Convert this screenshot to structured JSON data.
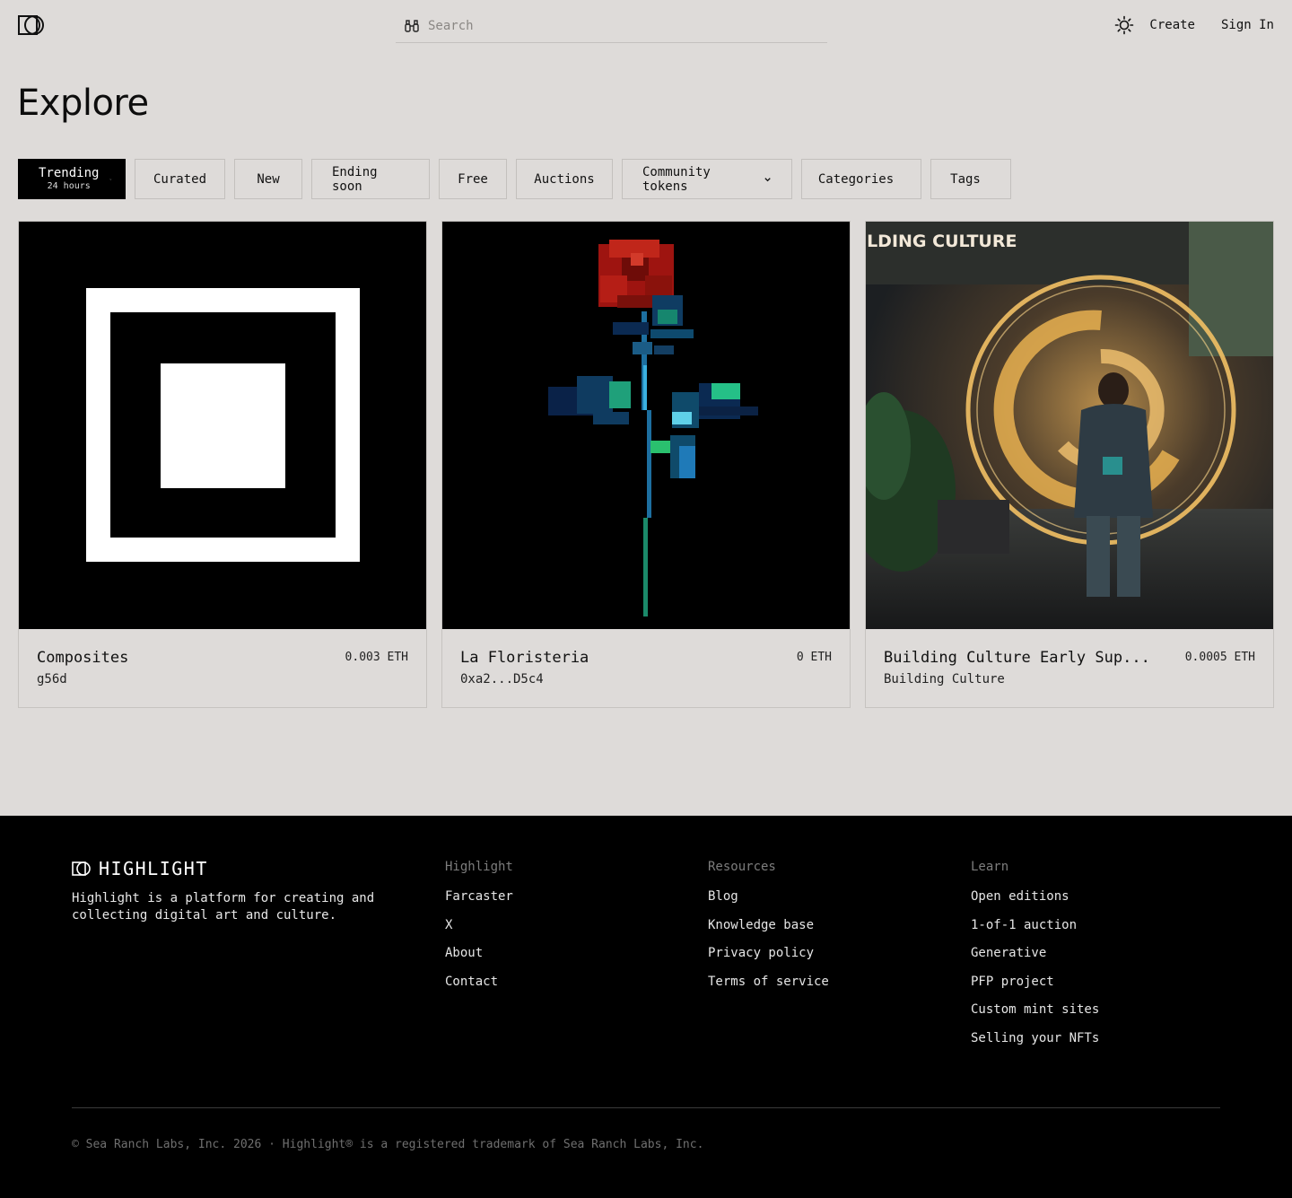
{
  "header": {
    "search_placeholder": "Search",
    "create_label": "Create",
    "signin_label": "Sign In"
  },
  "page": {
    "title": "Explore"
  },
  "filters": {
    "trending_label": "Trending",
    "trending_period": "24 hours",
    "items": [
      "Curated",
      "New",
      "Ending soon",
      "Free",
      "Auctions"
    ],
    "community_tokens": "Community tokens",
    "categories": "Categories",
    "tags": "Tags"
  },
  "cards": [
    {
      "title": "Composites",
      "creator": "g56d",
      "price": "0.003 ETH"
    },
    {
      "title": "La Floristeria",
      "creator": "0xa2...D5c4",
      "price": "0 ETH"
    },
    {
      "title": "Building Culture Early Sup...",
      "creator": "Building Culture",
      "price": "0.0005 ETH",
      "image_text": "ILDING CULTURE"
    }
  ],
  "footer": {
    "brand": "HIGHLIGHT",
    "description": "Highlight is a platform for creating and collecting digital art and culture.",
    "columns": [
      {
        "heading": "Highlight",
        "links": [
          "Farcaster",
          "X",
          "About",
          "Contact"
        ]
      },
      {
        "heading": "Resources",
        "links": [
          "Blog",
          "Knowledge base",
          "Privacy policy",
          "Terms of service"
        ]
      },
      {
        "heading": "Learn",
        "links": [
          "Open editions",
          "1-of-1 auction",
          "Generative",
          "PFP project",
          "Custom mint sites",
          "Selling your NFTs"
        ]
      }
    ],
    "copyright": "© Sea Ranch Labs, Inc. 2026 · Highlight® is a registered trademark of Sea Ranch Labs, Inc."
  },
  "colors": {
    "page_bg": "#dedbd9",
    "footer_bg": "#000000",
    "active_filter_bg": "#000000",
    "border": "#c3c0bd"
  },
  "icons": [
    "logo-icon",
    "binoculars-icon",
    "sun-icon",
    "chevron-down-icon"
  ]
}
